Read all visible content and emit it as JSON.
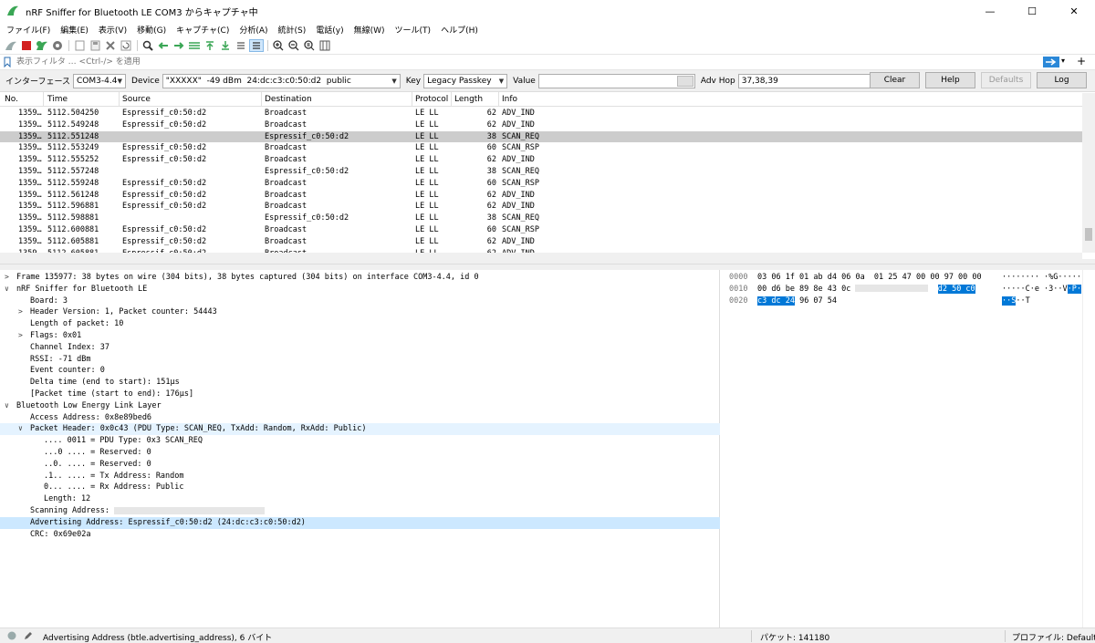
{
  "window": {
    "title": "nRF Sniffer for Bluetooth LE COM3 からキャプチャ中",
    "min": "—",
    "max": "☐",
    "close": "✕"
  },
  "menu": [
    "ファイル(F)",
    "編集(E)",
    "表示(V)",
    "移動(G)",
    "キャプチャ(C)",
    "分析(A)",
    "統計(S)",
    "電話(y)",
    "無線(W)",
    "ツール(T)",
    "ヘルプ(H)"
  ],
  "filter": {
    "placeholder": "表示フィルタ … <Ctrl-/> を適用"
  },
  "sniffer": {
    "interface_label": "インターフェース",
    "interface_value": "COM3-4.4",
    "device_label": "Device",
    "device_value": "\"XXXXX\"  -49 dBm  24:dc:c3:c0:50:d2  public",
    "key_label": "Key",
    "key_value": "Legacy Passkey",
    "value_label": "Value",
    "value_value": "",
    "advhop_label": "Adv Hop",
    "advhop_value": "37,38,39",
    "clear": "Clear",
    "help": "Help",
    "defaults": "Defaults",
    "log": "Log"
  },
  "packet_list": {
    "columns": [
      "No.",
      "Time",
      "Source",
      "Destination",
      "Protocol",
      "Length",
      "Info"
    ],
    "rows": [
      {
        "no": "1359…",
        "time": "5112.504250",
        "src": "Espressif_c0:50:d2",
        "dst": "Broadcast",
        "proto": "LE LL",
        "len": "62",
        "info": "ADV_IND",
        "sel": false
      },
      {
        "no": "1359…",
        "time": "5112.549248",
        "src": "Espressif_c0:50:d2",
        "dst": "Broadcast",
        "proto": "LE LL",
        "len": "62",
        "info": "ADV_IND",
        "sel": false
      },
      {
        "no": "1359…",
        "time": "5112.551248",
        "src": "",
        "dst": "Espressif_c0:50:d2",
        "proto": "LE LL",
        "len": "38",
        "info": "SCAN_REQ",
        "sel": true
      },
      {
        "no": "1359…",
        "time": "5112.553249",
        "src": "Espressif_c0:50:d2",
        "dst": "Broadcast",
        "proto": "LE LL",
        "len": "60",
        "info": "SCAN_RSP",
        "sel": false
      },
      {
        "no": "1359…",
        "time": "5112.555252",
        "src": "Espressif_c0:50:d2",
        "dst": "Broadcast",
        "proto": "LE LL",
        "len": "62",
        "info": "ADV_IND",
        "sel": false
      },
      {
        "no": "1359…",
        "time": "5112.557248",
        "src": "",
        "dst": "Espressif_c0:50:d2",
        "proto": "LE LL",
        "len": "38",
        "info": "SCAN_REQ",
        "sel": false
      },
      {
        "no": "1359…",
        "time": "5112.559248",
        "src": "Espressif_c0:50:d2",
        "dst": "Broadcast",
        "proto": "LE LL",
        "len": "60",
        "info": "SCAN_RSP",
        "sel": false
      },
      {
        "no": "1359…",
        "time": "5112.561248",
        "src": "Espressif_c0:50:d2",
        "dst": "Broadcast",
        "proto": "LE LL",
        "len": "62",
        "info": "ADV_IND",
        "sel": false
      },
      {
        "no": "1359…",
        "time": "5112.596881",
        "src": "Espressif_c0:50:d2",
        "dst": "Broadcast",
        "proto": "LE LL",
        "len": "62",
        "info": "ADV_IND",
        "sel": false
      },
      {
        "no": "1359…",
        "time": "5112.598881",
        "src": "",
        "dst": "Espressif_c0:50:d2",
        "proto": "LE LL",
        "len": "38",
        "info": "SCAN_REQ",
        "sel": false
      },
      {
        "no": "1359…",
        "time": "5112.600881",
        "src": "Espressif_c0:50:d2",
        "dst": "Broadcast",
        "proto": "LE LL",
        "len": "60",
        "info": "SCAN_RSP",
        "sel": false
      },
      {
        "no": "1359…",
        "time": "5112.605881",
        "src": "Espressif_c0:50:d2",
        "dst": "Broadcast",
        "proto": "LE LL",
        "len": "62",
        "info": "ADV_IND",
        "sel": false
      },
      {
        "no": "1359…",
        "time": "5112.605881",
        "src": "Espressif_c0:50:d2",
        "dst": "Broadcast",
        "proto": "LE LL",
        "len": "62",
        "info": "ADV_IND",
        "sel": false
      }
    ]
  },
  "details": [
    {
      "level": 0,
      "tw": ">",
      "text": "Frame 135977: 38 bytes on wire (304 bits), 38 bytes captured (304 bits) on interface COM3-4.4, id 0",
      "hl": ""
    },
    {
      "level": 0,
      "tw": "∨",
      "text": "nRF Sniffer for Bluetooth LE",
      "hl": ""
    },
    {
      "level": 1,
      "tw": "",
      "text": "Board: 3",
      "hl": ""
    },
    {
      "level": 1,
      "tw": ">",
      "text": "Header Version: 1, Packet counter: 54443",
      "hl": ""
    },
    {
      "level": 1,
      "tw": "",
      "text": "Length of packet: 10",
      "hl": ""
    },
    {
      "level": 1,
      "tw": ">",
      "text": "Flags: 0x01",
      "hl": ""
    },
    {
      "level": 1,
      "tw": "",
      "text": "Channel Index: 37",
      "hl": ""
    },
    {
      "level": 1,
      "tw": "",
      "text": "RSSI: -71 dBm",
      "hl": ""
    },
    {
      "level": 1,
      "tw": "",
      "text": "Event counter: 0",
      "hl": ""
    },
    {
      "level": 1,
      "tw": "",
      "text": "Delta time (end to start): 151µs",
      "hl": ""
    },
    {
      "level": 1,
      "tw": "",
      "text": "[Packet time (start to end): 176µs]",
      "hl": ""
    },
    {
      "level": 0,
      "tw": "∨",
      "text": "Bluetooth Low Energy Link Layer",
      "hl": ""
    },
    {
      "level": 1,
      "tw": "",
      "text": "Access Address: 0x8e89bed6",
      "hl": ""
    },
    {
      "level": 1,
      "tw": "∨",
      "text": "Packet Header: 0x0c43 (PDU Type: SCAN_REQ, TxAdd: Random, RxAdd: Public)",
      "hl": "ghl"
    },
    {
      "level": 2,
      "tw": "",
      "text": ".... 0011 = PDU Type: 0x3 SCAN_REQ",
      "hl": ""
    },
    {
      "level": 2,
      "tw": "",
      "text": "...0 .... = Reserved: 0",
      "hl": ""
    },
    {
      "level": 2,
      "tw": "",
      "text": "..0. .... = Reserved: 0",
      "hl": ""
    },
    {
      "level": 2,
      "tw": "",
      "text": ".1.. .... = Tx Address: Random",
      "hl": ""
    },
    {
      "level": 2,
      "tw": "",
      "text": "0... .... = Rx Address: Public",
      "hl": ""
    },
    {
      "level": 2,
      "tw": "",
      "text": "Length: 12",
      "hl": ""
    },
    {
      "level": 1,
      "tw": "",
      "text": "Scanning Address: ",
      "hl": "",
      "redacted": true
    },
    {
      "level": 1,
      "tw": "",
      "text": "Advertising Address: Espressif_c0:50:d2 (24:dc:c3:c0:50:d2)",
      "hl": "hl"
    },
    {
      "level": 1,
      "tw": "",
      "text": "CRC: 0x69e02a",
      "hl": ""
    }
  ],
  "hex": [
    {
      "offset": "0000",
      "pre": "03 06 1f 01 ab d4 06 0a  01 25 47 00 00 97 00 00",
      "redacted": false,
      "selhex": "",
      "ascii_pre": "········ ·%G·····",
      "ascii_sel": "",
      "ascii_post": ""
    },
    {
      "offset": "0010",
      "pre": "00 d6 be 89 8e 43 0c ",
      "redacted": true,
      "selhex": "d2 50 c0",
      "ascii_pre": "·····C·e ·3··V",
      "ascii_sel": "·P·",
      "ascii_post": ""
    },
    {
      "offset": "0020",
      "pre": "",
      "redacted": false,
      "selhex": "c3 dc 24",
      "hexpost": " 96 07 54",
      "ascii_pre": "",
      "ascii_sel": "··S",
      "ascii_post": "··T"
    }
  ],
  "status": {
    "field": "Advertising Address (btle.advertising_address), 6 バイト",
    "packets": "パケット: 141180",
    "profile": "プロファイル: Default"
  }
}
